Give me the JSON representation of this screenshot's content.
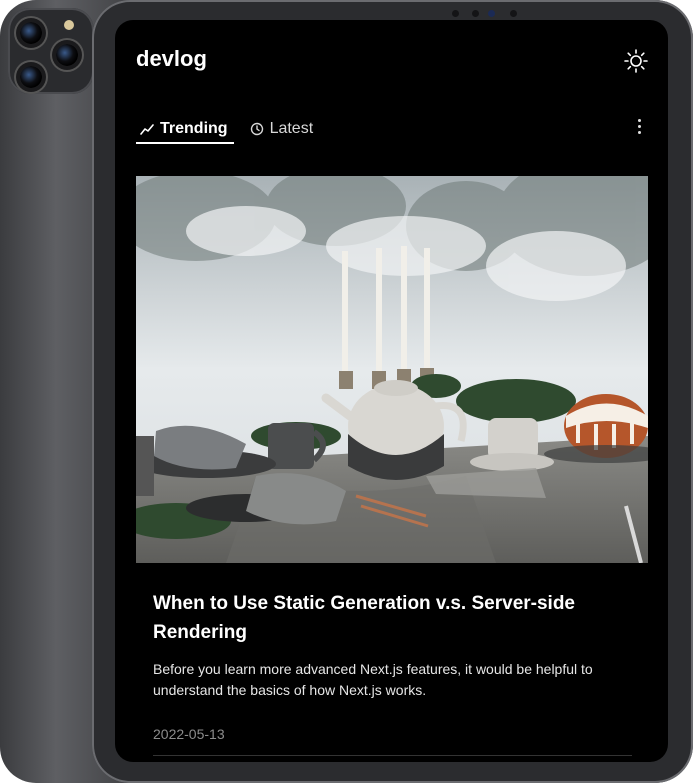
{
  "site": {
    "logo": "devlog",
    "theme_icon": "sun-icon"
  },
  "tabs": [
    {
      "label": "Trending",
      "icon": "trending-icon",
      "active": true
    },
    {
      "label": "Latest",
      "icon": "clock-icon",
      "active": false
    }
  ],
  "menu": {
    "icon": "more-vertical-icon"
  },
  "post": {
    "title": "When to Use Static Generation v.s. Server-side Rendering",
    "description": "Before you learn more advanced Next.js features, it would be helpful to understand the basics of how Next.js works.",
    "date": "2022-05-13"
  },
  "colors": {
    "background": "#000000",
    "text": "#ffffff",
    "muted": "#8c8c8c"
  }
}
